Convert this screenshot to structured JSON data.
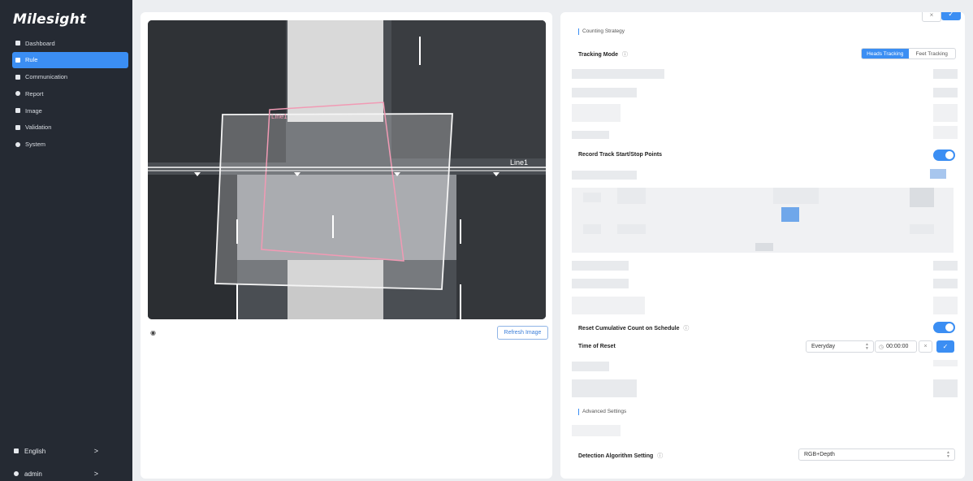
{
  "sidebar": {
    "logo": "Milesight",
    "items": [
      {
        "label": "Dashboard",
        "icon": "dashboard-icon"
      },
      {
        "label": "Rule",
        "icon": "rule-icon",
        "active": true
      },
      {
        "label": "Communication",
        "icon": "communication-icon"
      },
      {
        "label": "Report",
        "icon": "report-icon"
      },
      {
        "label": "Image",
        "icon": "image-icon"
      },
      {
        "label": "Validation",
        "icon": "validation-icon"
      },
      {
        "label": "System",
        "icon": "gear-icon"
      }
    ],
    "language": {
      "label": "English",
      "chevron": ">"
    },
    "user": {
      "label": "admin",
      "chevron": ">"
    }
  },
  "camera": {
    "lines": [
      "Line1",
      "Line1"
    ]
  },
  "left_panel": {
    "eye_icon": "eye-icon",
    "refresh_label": "Refresh Image"
  },
  "right_panel": {
    "top_cancel": "×",
    "top_confirm": "✓",
    "counting_strategy": "Counting Strategy",
    "tracking_mode_label": "Tracking Mode",
    "tracking_options": [
      "Heads Tracking",
      "Feet Tracking"
    ],
    "record_track_label": "Record Track Start/Stop Points",
    "reset_count_label": "Reset Cumulative Count on Schedule",
    "time_of_reset_label": "Time of Reset",
    "reset_frequency": "Everyday",
    "reset_time": "00:00:00",
    "small_cancel": "×",
    "small_confirm": "✓",
    "advanced_settings": "Advanced Settings",
    "detection_label": "Detection Algorithm Setting",
    "detection_value": "RGB+Depth",
    "info_icon": "ⓘ",
    "clock_icon": "◷",
    "accent": "#3b8ef3"
  }
}
